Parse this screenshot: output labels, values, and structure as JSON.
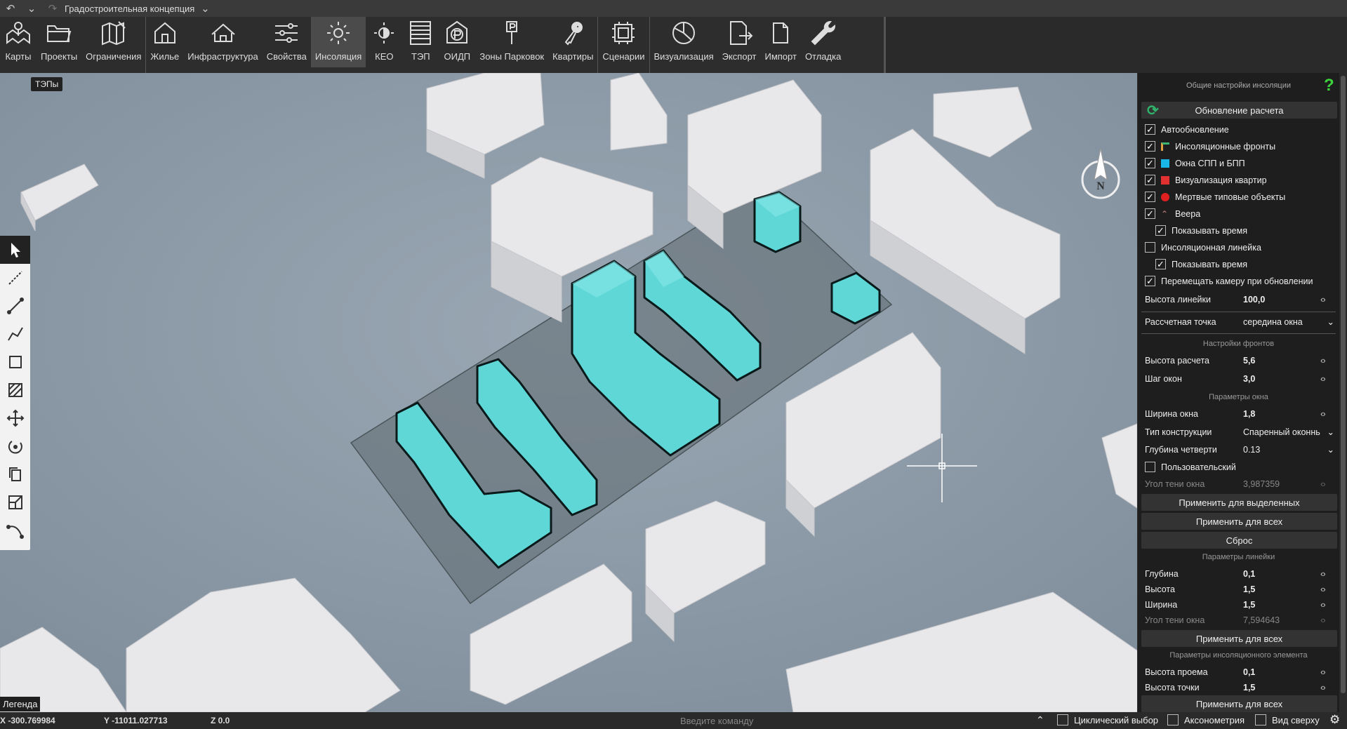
{
  "titlebar": {
    "title": "Градостроительная концепция"
  },
  "toolbar": {
    "tools": [
      {
        "label": "Карты",
        "icon": "map-pin-icon"
      },
      {
        "label": "Проекты",
        "icon": "folder-icon"
      },
      {
        "label": "Ограничения",
        "icon": "map-restrict-icon"
      },
      {
        "label": "Жилье",
        "icon": "house-icon"
      },
      {
        "label": "Инфраструктура",
        "icon": "infrastructure-icon"
      },
      {
        "label": "Свойства",
        "icon": "sliders-icon"
      },
      {
        "label": "Инсоляция",
        "icon": "sun-icon"
      },
      {
        "label": "КЕО",
        "icon": "light-icon"
      },
      {
        "label": "ТЭП",
        "icon": "table-icon"
      },
      {
        "label": "ОИДП",
        "icon": "ruble-house-icon"
      },
      {
        "label": "Зоны Парковок",
        "icon": "parking-sign-icon"
      },
      {
        "label": "Квартиры",
        "icon": "keys-icon"
      },
      {
        "label": "Сценарии",
        "icon": "scenario-icon"
      },
      {
        "label": "Визуализация",
        "icon": "pie-icon"
      },
      {
        "label": "Экспорт",
        "icon": "export-icon"
      },
      {
        "label": "Импорт",
        "icon": "import-icon"
      },
      {
        "label": "Отладка",
        "icon": "wrench-icon"
      }
    ],
    "active": "Инсоляция"
  },
  "viewport": {
    "badge": "ТЭПы",
    "compass_letter": "N"
  },
  "panel": {
    "header": "Общие настройки инсоляции",
    "help": "?",
    "update_button": "Обновление расчета",
    "checkboxes": [
      {
        "label": "Автообновление",
        "checked": true
      },
      {
        "label": "Инсоляционные фронты",
        "checked": true,
        "swatch": "#e0a040"
      },
      {
        "label": "Окна СПП и БПП",
        "checked": true,
        "swatch": "#19b6e8"
      },
      {
        "label": "Визуализация квартир",
        "checked": true,
        "swatch": "#e03030"
      },
      {
        "label": "Мертвые типовые объекты",
        "checked": true,
        "swatch": "#e02020"
      },
      {
        "label": "Веера",
        "checked": true,
        "swatch": "#d08080"
      },
      {
        "label": "Показывать время",
        "checked": true
      },
      {
        "label": "Инсоляционная линейка",
        "checked": false
      },
      {
        "label": "Показывать время",
        "checked": true
      },
      {
        "label": "Перемещать камеру при обновлении",
        "checked": true
      }
    ],
    "ruler_height": {
      "label": "Высота линейки",
      "value": "100,0"
    },
    "calc_point": {
      "label": "Рассчетная точка",
      "value": "середина окна"
    },
    "fronts_section": "Настройки фронтов",
    "calc_height": {
      "label": "Высота расчета",
      "value": "5,6"
    },
    "window_step": {
      "label": "Шаг окон",
      "value": "3,0"
    },
    "window_section": "Параметры окна",
    "window_width": {
      "label": "Ширина окна",
      "value": "1,8"
    },
    "construction": {
      "label": "Тип конструкции",
      "value": "Спаренный оконнь"
    },
    "quarter_depth": {
      "label": "Глубина четверти",
      "value": "0.13"
    },
    "custom": {
      "label": "Пользовательский",
      "checked": false
    },
    "shadow_angle": {
      "label": "Угол тени окна",
      "value": "3,987359"
    },
    "apply_selected": "Применить для выделенных",
    "apply_all_1": "Применить для всех",
    "reset": "Сброс",
    "ruler_section": "Параметры линейки",
    "depth": {
      "label": "Глубина",
      "value": "0,1"
    },
    "height": {
      "label": "Высота",
      "value": "1,5"
    },
    "width": {
      "label": "Ширина",
      "value": "1,5"
    },
    "shadow_angle_2": {
      "label": "Угол тени окна",
      "value": "7,594643"
    },
    "apply_all_2": "Применить для всех",
    "element_section": "Параметры инсоляционного элемента",
    "opening_height": {
      "label": "Высота проема",
      "value": "0,1"
    },
    "point_height": {
      "label": "Высота точки",
      "value": "1,5"
    },
    "apply_all_3": "Применить для всех"
  },
  "statusbar": {
    "x": "X -300.769984",
    "y": "Y -11011.027713",
    "z": "Z 0.0",
    "legend": "Легенда",
    "command_placeholder": "Введите команду",
    "cyclic": "Циклический выбор",
    "axonometry": "Аксонометрия",
    "top_view": "Вид сверху"
  }
}
